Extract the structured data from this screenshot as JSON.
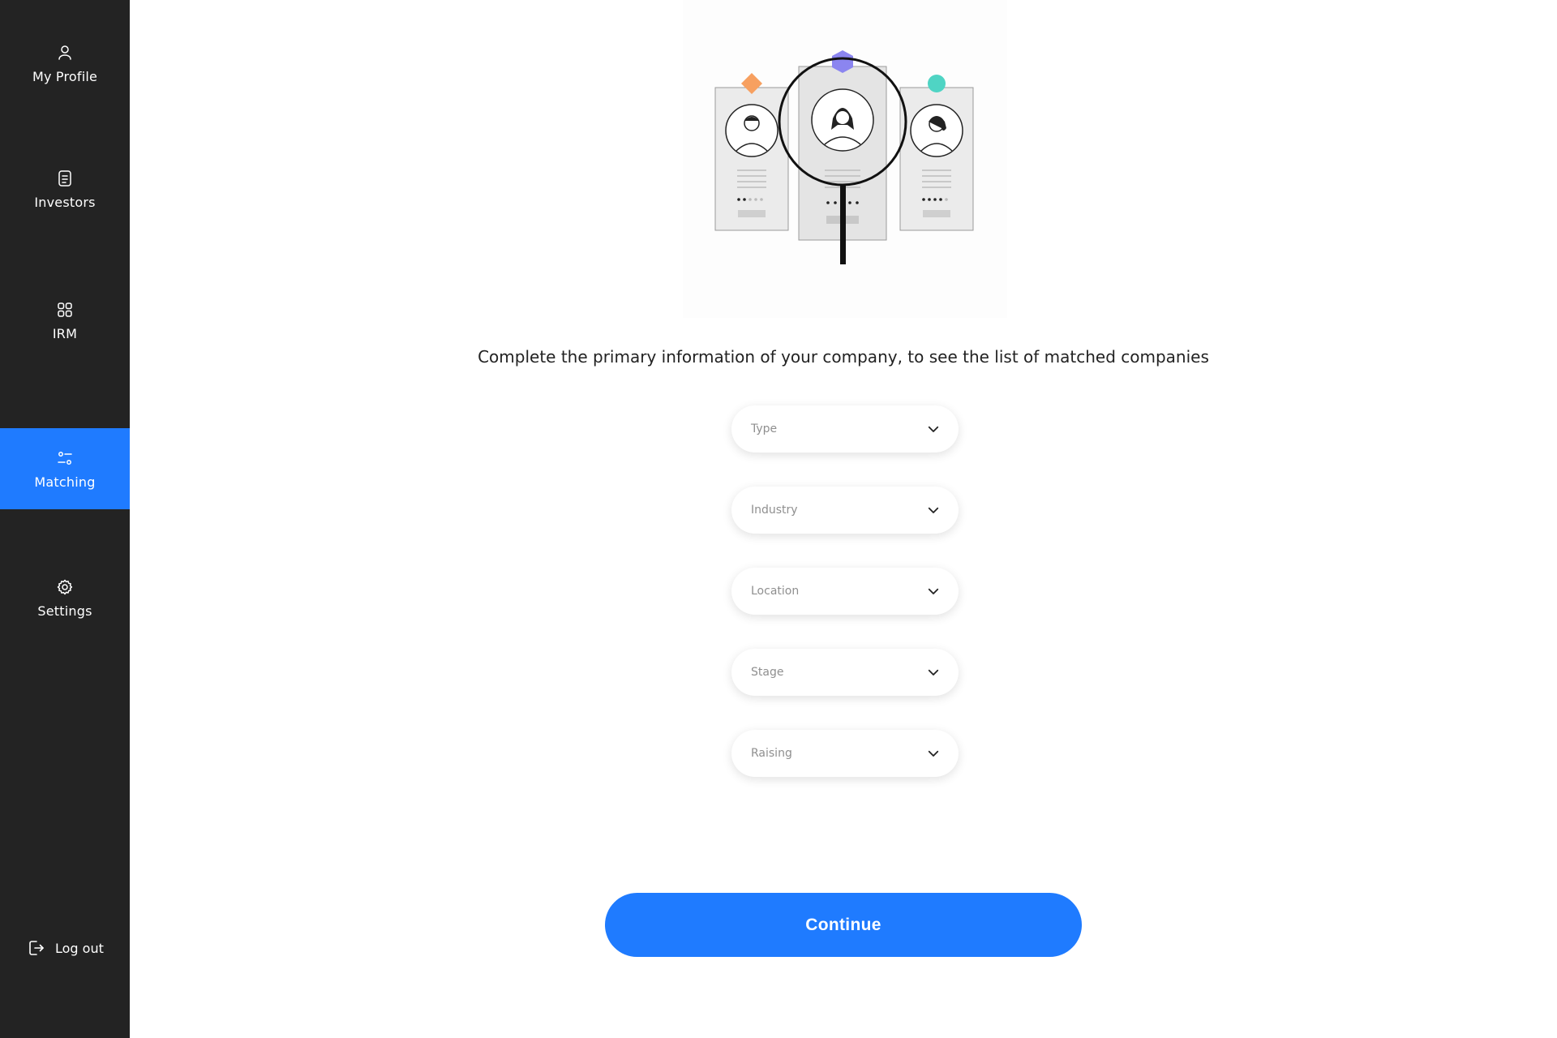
{
  "sidebar": {
    "items": [
      {
        "label": "My Profile",
        "icon": "user-icon"
      },
      {
        "label": "Investors",
        "icon": "document-icon"
      },
      {
        "label": "IRM",
        "icon": "grid-icon"
      },
      {
        "label": "Matching",
        "icon": "sliders-icon",
        "active": true
      },
      {
        "label": "Settings",
        "icon": "gear-icon"
      }
    ],
    "logout_label": "Log out",
    "active_color": "#1f7bff",
    "background": "#232323"
  },
  "main": {
    "headline": "Complete the primary information of your company, to see the list of matched companies",
    "fields": [
      {
        "placeholder": "Type"
      },
      {
        "placeholder": "Industry"
      },
      {
        "placeholder": "Location"
      },
      {
        "placeholder": "Stage"
      },
      {
        "placeholder": "Raising"
      }
    ],
    "continue_label": "Continue"
  }
}
